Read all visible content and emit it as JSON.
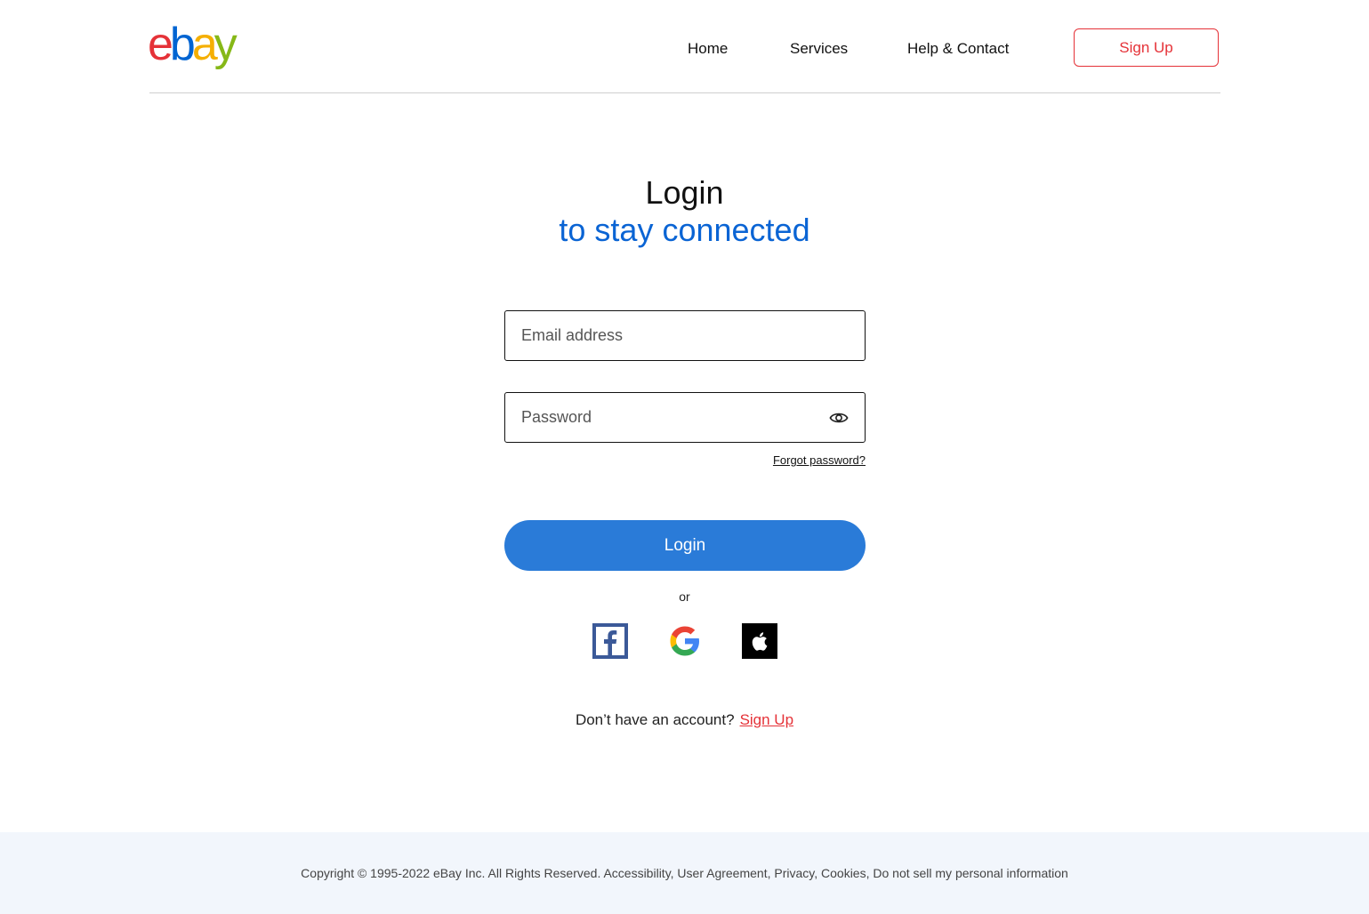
{
  "header": {
    "logo": [
      "e",
      "b",
      "a",
      "y"
    ],
    "logo_colors": [
      "#e53238",
      "#0064d2",
      "#f5af02",
      "#86b817"
    ],
    "nav": [
      "Home",
      "Services",
      "Help & Contact"
    ],
    "signup_label": "Sign Up"
  },
  "main": {
    "title": "Login",
    "subtitle": "to stay connected",
    "email_placeholder": "Email address",
    "password_placeholder": "Password",
    "forgot_label": "Forgot password?",
    "login_label": "Login",
    "or_label": "or",
    "social": [
      "facebook-icon",
      "google-icon",
      "apple-icon"
    ],
    "no_account_text": "Don’t have an account?",
    "signup_link": "Sign Up"
  },
  "footer": {
    "text": "Copyright © 1995-2022 eBay Inc. All Rights Reserved. Accessibility, User Agreement, Privacy, Cookies, Do not sell my personal information"
  },
  "colors": {
    "accent_blue": "#2a7bd8",
    "subtitle_blue": "#0a64d4",
    "brand_red": "#e53238"
  }
}
